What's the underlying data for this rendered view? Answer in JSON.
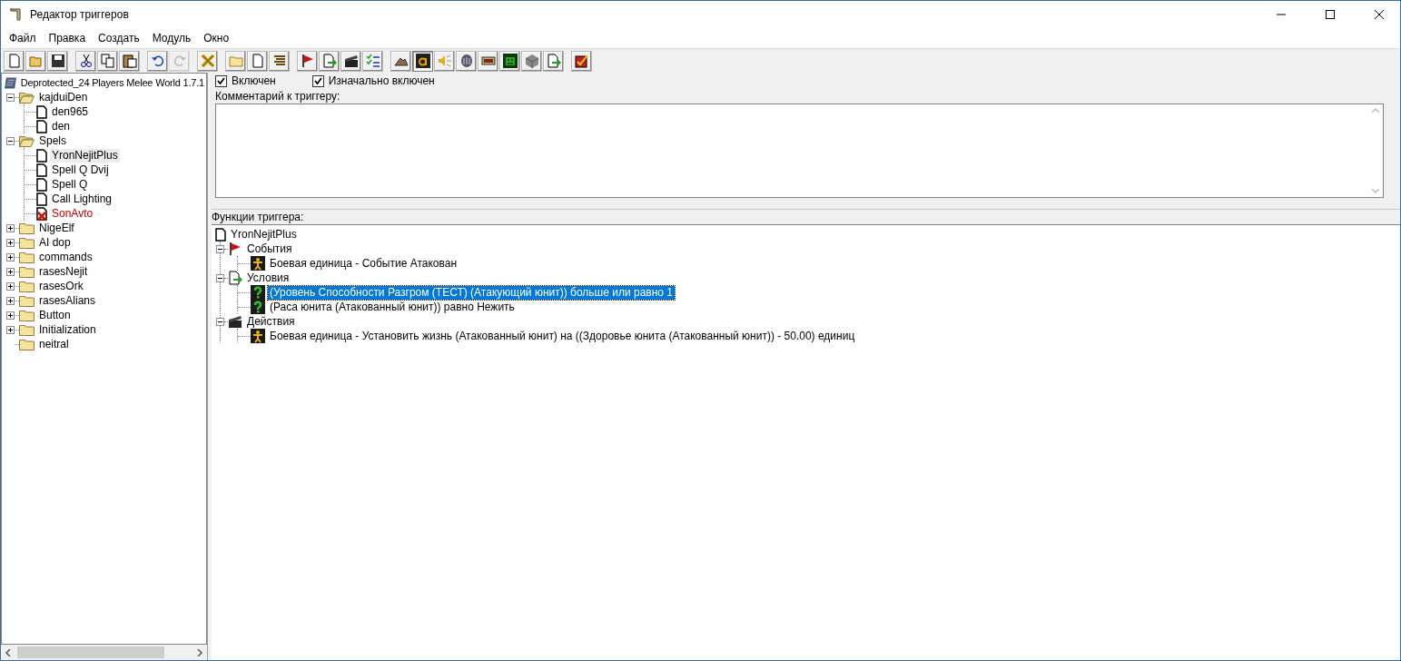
{
  "window": {
    "title": "Редактор триггеров"
  },
  "menu": [
    "Файл",
    "Правка",
    "Создать",
    "Модуль",
    "Окно"
  ],
  "toolbar": [
    [
      {
        "kind": "new",
        "disabled": false,
        "pressed": false
      },
      {
        "kind": "open",
        "disabled": false,
        "pressed": false
      },
      {
        "kind": "save",
        "disabled": false,
        "pressed": false
      }
    ],
    [
      {
        "kind": "cut",
        "disabled": false,
        "pressed": false
      },
      {
        "kind": "copy",
        "disabled": false,
        "pressed": false
      },
      {
        "kind": "paste",
        "disabled": false,
        "pressed": false
      }
    ],
    [
      {
        "kind": "undo",
        "disabled": false,
        "pressed": false
      },
      {
        "kind": "redo",
        "disabled": true,
        "pressed": false
      }
    ],
    [
      {
        "kind": "x",
        "disabled": false,
        "pressed": false
      }
    ],
    [
      {
        "kind": "folder",
        "disabled": false,
        "pressed": false
      },
      {
        "kind": "doc",
        "disabled": false,
        "pressed": false
      },
      {
        "kind": "lines",
        "disabled": false,
        "pressed": false
      }
    ],
    [
      {
        "kind": "flag",
        "disabled": false,
        "pressed": false
      },
      {
        "kind": "docarrow",
        "disabled": false,
        "pressed": false
      },
      {
        "kind": "clapper",
        "disabled": false,
        "pressed": false
      },
      {
        "kind": "checklist",
        "disabled": false,
        "pressed": false
      }
    ],
    [
      {
        "kind": "terrain",
        "disabled": false,
        "pressed": false
      },
      {
        "kind": "lettera",
        "disabled": false,
        "pressed": true
      },
      {
        "kind": "speaker",
        "disabled": false,
        "pressed": false
      },
      {
        "kind": "mask",
        "disabled": false,
        "pressed": false
      },
      {
        "kind": "panel",
        "disabled": false,
        "pressed": false
      },
      {
        "kind": "monster",
        "disabled": false,
        "pressed": false
      },
      {
        "kind": "cube",
        "disabled": false,
        "pressed": false
      },
      {
        "kind": "docimport",
        "disabled": false,
        "pressed": false
      }
    ],
    [
      {
        "kind": "checkbox",
        "disabled": false,
        "pressed": false
      }
    ]
  ],
  "trigger_tree": {
    "root": "Deprotected_24 Players Melee World 1.7.1",
    "folders": [
      {
        "label": "kajduiDen",
        "expanded": true,
        "selected": false,
        "children": [
          {
            "label": "den965",
            "selected": false,
            "enabled": true
          },
          {
            "label": "den",
            "selected": false,
            "enabled": true
          }
        ]
      },
      {
        "label": "Spels",
        "expanded": true,
        "selected": false,
        "children": [
          {
            "label": "YronNejitPlus",
            "selected": true,
            "enabled": true
          },
          {
            "label": "Spell Q Dvij",
            "selected": false,
            "enabled": true
          },
          {
            "label": "Spell Q",
            "selected": false,
            "enabled": true
          },
          {
            "label": "Call Lighting",
            "selected": false,
            "enabled": true
          },
          {
            "label": "SonAvto",
            "selected": false,
            "enabled": false
          }
        ]
      },
      {
        "label": "NigeElf",
        "expanded": false,
        "selected": false
      },
      {
        "label": "AI dop",
        "expanded": false,
        "selected": false
      },
      {
        "label": "commands",
        "expanded": false,
        "selected": false
      },
      {
        "label": "rasesNejit",
        "expanded": false,
        "selected": false
      },
      {
        "label": "rasesOrk",
        "expanded": false,
        "selected": false
      },
      {
        "label": "rasesAlians",
        "expanded": false,
        "selected": false
      },
      {
        "label": "Button",
        "expanded": false,
        "selected": false
      },
      {
        "label": "Initialization",
        "expanded": false,
        "selected": false
      },
      {
        "label": "neitral",
        "selected": false
      }
    ]
  },
  "options": [
    {
      "label": "Включен",
      "checked": true
    },
    {
      "label": "Изначально включен",
      "checked": true
    }
  ],
  "comment": {
    "label": "Комментарий к триггеру:"
  },
  "functions": {
    "label": "Функции триггера:",
    "root": "YronNejitPlus",
    "sections": [
      {
        "kind": "events",
        "label": "События",
        "expanded": true,
        "children": [
          {
            "kind": "unit",
            "label": "Боевая единица - Событие Атакован",
            "selected": false
          }
        ]
      },
      {
        "kind": "conditions",
        "label": "Условия",
        "expanded": true,
        "children": [
          {
            "kind": "condition",
            "label": "(Уровень Способности Разгром (ТЕСТ) (Атакующий юнит)) больше или равно 1",
            "selected": true
          },
          {
            "kind": "condition",
            "label": "(Раса юнита (Атакованный юнит)) равно Нежить",
            "selected": false
          }
        ]
      },
      {
        "kind": "actions",
        "label": "Действия",
        "expanded": true,
        "children": [
          {
            "kind": "unit",
            "label": "Боевая единица - Установить жизнь (Атакованный юнит) на ((Здоровье юнита (Атакованный юнит)) - 50.00) единиц",
            "selected": false
          }
        ]
      }
    ]
  }
}
